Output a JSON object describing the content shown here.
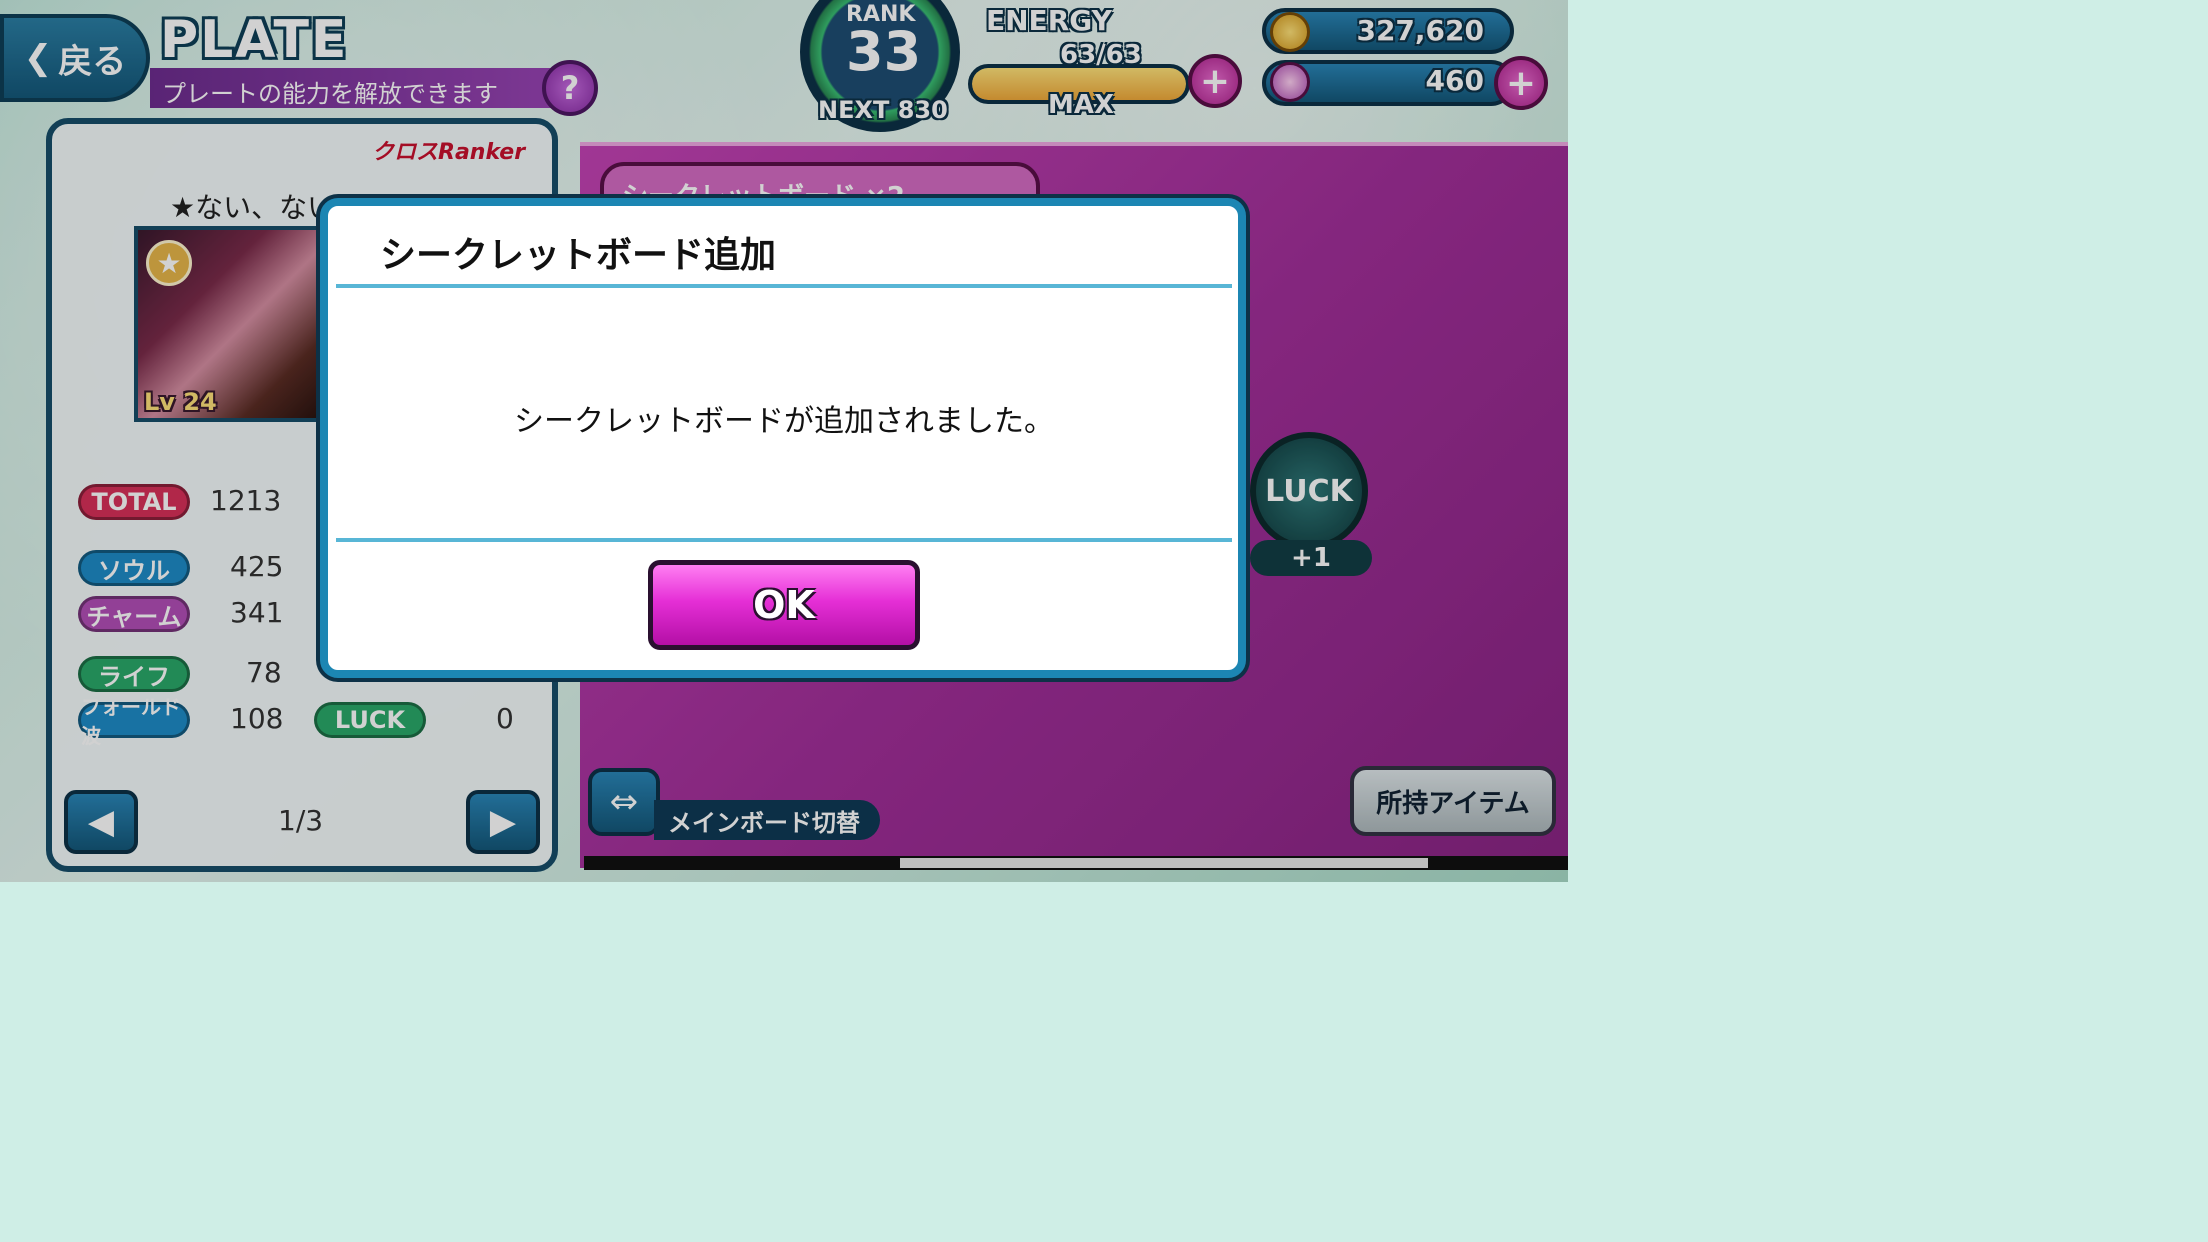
{
  "header": {
    "back_label": "戻る",
    "title": "PLATE",
    "subtitle": "プレートの能力を解放できます",
    "help_label": "?"
  },
  "rank": {
    "label": "RANK",
    "value": "33",
    "next": "NEXT 830"
  },
  "energy": {
    "label": "ENERGY",
    "value": "63/63",
    "fill_fraction": 1.0,
    "max_label": "MAX"
  },
  "currency": {
    "coins": "327,620",
    "gems": "460"
  },
  "plate": {
    "logo_text": "クロスRanker",
    "character_name": "★ない、ないない?",
    "card_level": "Lv 24",
    "stats": {
      "total_label": "TOTAL",
      "total_value": "1213",
      "soul_label": "ソウル",
      "soul_value": "425",
      "charm_label": "チャーム",
      "charm_value": "341",
      "life_label": "ライフ",
      "life_value": "78",
      "fold_label": "フォールド波",
      "fold_value": "108",
      "luck_label": "LUCK",
      "luck_value": "0"
    },
    "page": "1/3"
  },
  "board": {
    "tab_label": "シークレットボード ×2",
    "luck_node_label": "LUCK",
    "luck_node_bonus": "+1",
    "switch_label": "メインボード切替",
    "items_label": "所持アイテム"
  },
  "dialog": {
    "title": "シークレットボード追加",
    "message": "シークレットボードが追加されました。",
    "ok_label": "OK"
  }
}
